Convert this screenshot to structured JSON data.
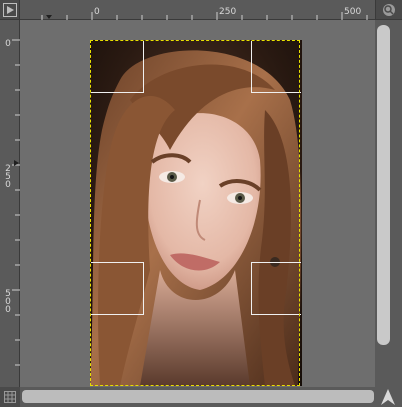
{
  "rulers": {
    "horizontal_labels": [
      "0",
      "250",
      "500"
    ],
    "vertical_labels": [
      {
        "text": "0",
        "chars": [
          "0"
        ]
      },
      {
        "text": "250",
        "chars": [
          "2",
          "5",
          "0"
        ]
      },
      {
        "text": "500",
        "chars": [
          "5",
          "0",
          "0"
        ]
      }
    ]
  },
  "canvas": {
    "image_description_icon": "portrait-photo",
    "selection_border_color": "#e8e000",
    "guide_color": "#f0f0f0",
    "background_color": "#6e6e6e"
  },
  "icons": {
    "top_left": "play-icon",
    "top_right": "zoom-icon",
    "bottom_left": "grid-icon",
    "bottom_right": "navigate-icon"
  }
}
